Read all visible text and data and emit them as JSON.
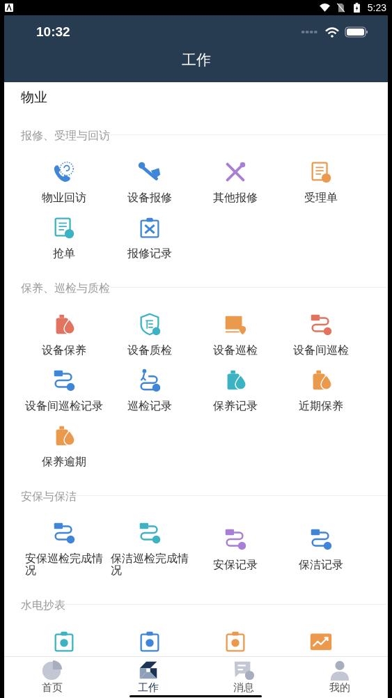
{
  "system_status": {
    "time": "5:23"
  },
  "app_status": {
    "time": "10:32"
  },
  "header": {
    "title": "工作"
  },
  "page_title": "物业",
  "sections": [
    {
      "title": "报修、受理与回访",
      "items": [
        {
          "label": "物业回访",
          "color": "#3f86d8"
        },
        {
          "label": "设备报修",
          "color": "#3f86d8"
        },
        {
          "label": "其他报修",
          "color": "#a77fd6"
        },
        {
          "label": "受理单",
          "color": "#eb9a4d"
        },
        {
          "label": "抢单",
          "color": "#3bb3c3"
        },
        {
          "label": "报修记录",
          "color": "#3f86d8"
        }
      ]
    },
    {
      "title": "保养、巡检与质检",
      "items": [
        {
          "label": "设备保养",
          "color": "#e2735f"
        },
        {
          "label": "设备质检",
          "color": "#3bb3c3"
        },
        {
          "label": "设备巡检",
          "color": "#eb9a4d"
        },
        {
          "label": "设备间巡检",
          "color": "#e2735f"
        },
        {
          "label": "设备间巡检记录",
          "color": "#3f86d8"
        },
        {
          "label": "巡检记录",
          "color": "#3f86d8"
        },
        {
          "label": "保养记录",
          "color": "#3bb3c3"
        },
        {
          "label": "近期保养",
          "color": "#eb9a4d"
        },
        {
          "label": "保养逾期",
          "color": "#eb9a4d"
        }
      ]
    },
    {
      "title": "安保与保洁",
      "items": [
        {
          "label": "安保巡检完成情况",
          "color": "#3f86d8"
        },
        {
          "label": "保洁巡检完成情况",
          "color": "#3bb3c3"
        },
        {
          "label": "安保记录",
          "color": "#a77fd6"
        },
        {
          "label": "保洁记录",
          "color": "#3f86d8"
        }
      ]
    },
    {
      "title": "水电抄表",
      "items": [
        {
          "color": "#3bb3c3"
        },
        {
          "color": "#3f86d8"
        },
        {
          "color": "#eb9a4d"
        },
        {
          "color": "#eb9a4d"
        }
      ]
    }
  ],
  "nav": [
    {
      "label": "首页",
      "selected": false
    },
    {
      "label": "工作",
      "selected": true
    },
    {
      "label": "消息",
      "selected": false
    },
    {
      "label": "我的",
      "selected": false
    }
  ]
}
